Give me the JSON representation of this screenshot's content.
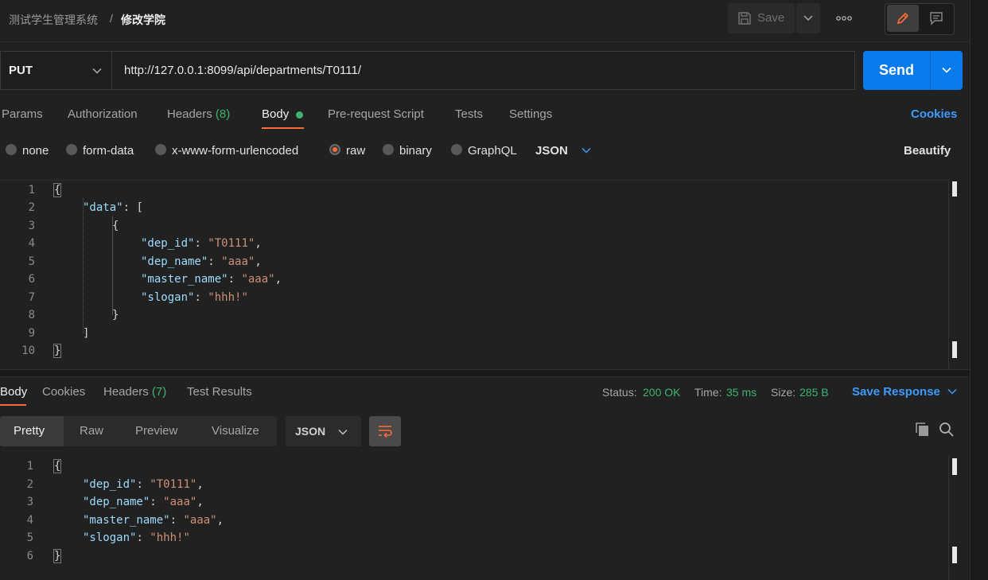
{
  "breadcrumb": {
    "root": "测试学生管理系统",
    "separator": "/",
    "current": "修改学院"
  },
  "toolbar": {
    "save_label": "Save"
  },
  "request": {
    "method": "PUT",
    "url": "http://127.0.0.1:8099/api/departments/T0111/",
    "send_label": "Send"
  },
  "request_tabs": {
    "params": "Params",
    "authorization": "Authorization",
    "headers": "Headers",
    "headers_count": "(8)",
    "body": "Body",
    "pre_request": "Pre-request Script",
    "tests": "Tests",
    "settings": "Settings",
    "cookies": "Cookies"
  },
  "body_types": {
    "none": "none",
    "form_data": "form-data",
    "urlencoded": "x-www-form-urlencoded",
    "raw": "raw",
    "binary": "binary",
    "graphql": "GraphQL",
    "language": "JSON",
    "selected": "raw",
    "beautify": "Beautify"
  },
  "request_body": {
    "line_numbers": [
      "1",
      "2",
      "3",
      "4",
      "5",
      "6",
      "7",
      "8",
      "9",
      "10"
    ],
    "lines": [
      "{",
      "\"data\": [",
      "{",
      "\"dep_id\": \"T0111\",",
      "\"dep_name\": \"aaa\",",
      "\"master_name\": \"aaa\",",
      "\"slogan\": \"hhh!\"",
      "}",
      "]",
      "}"
    ]
  },
  "response_tabs": {
    "body": "Body",
    "cookies": "Cookies",
    "headers": "Headers",
    "headers_count": "(7)",
    "test_results": "Test Results"
  },
  "response_meta": {
    "status_label": "Status:",
    "status_value": "200 OK",
    "time_label": "Time:",
    "time_value": "35 ms",
    "size_label": "Size:",
    "size_value": "285 B",
    "save_response": "Save Response"
  },
  "response_view": {
    "pretty": "Pretty",
    "raw": "Raw",
    "preview": "Preview",
    "visualize": "Visualize",
    "language": "JSON"
  },
  "response_body": {
    "line_numbers": [
      "1",
      "2",
      "3",
      "4",
      "5",
      "6"
    ],
    "lines": [
      "{",
      "\"dep_id\": \"T0111\",",
      "\"dep_name\": \"aaa\",",
      "\"master_name\": \"aaa\",",
      "\"slogan\": \"hhh!\"",
      "}"
    ]
  },
  "colors": {
    "accent": "#097bed",
    "link": "#3d9bff",
    "success": "#3cb371",
    "active_tab_underline": "#ff6c37",
    "json_key": "#9cdcfe",
    "json_string": "#ce9178"
  },
  "icons": {
    "save": "save-icon",
    "more": "more-horizontal-icon",
    "edit": "pencil-icon",
    "comment": "comment-icon",
    "copy": "copy-icon",
    "search": "search-icon",
    "wrap": "wrap-lines-icon"
  }
}
